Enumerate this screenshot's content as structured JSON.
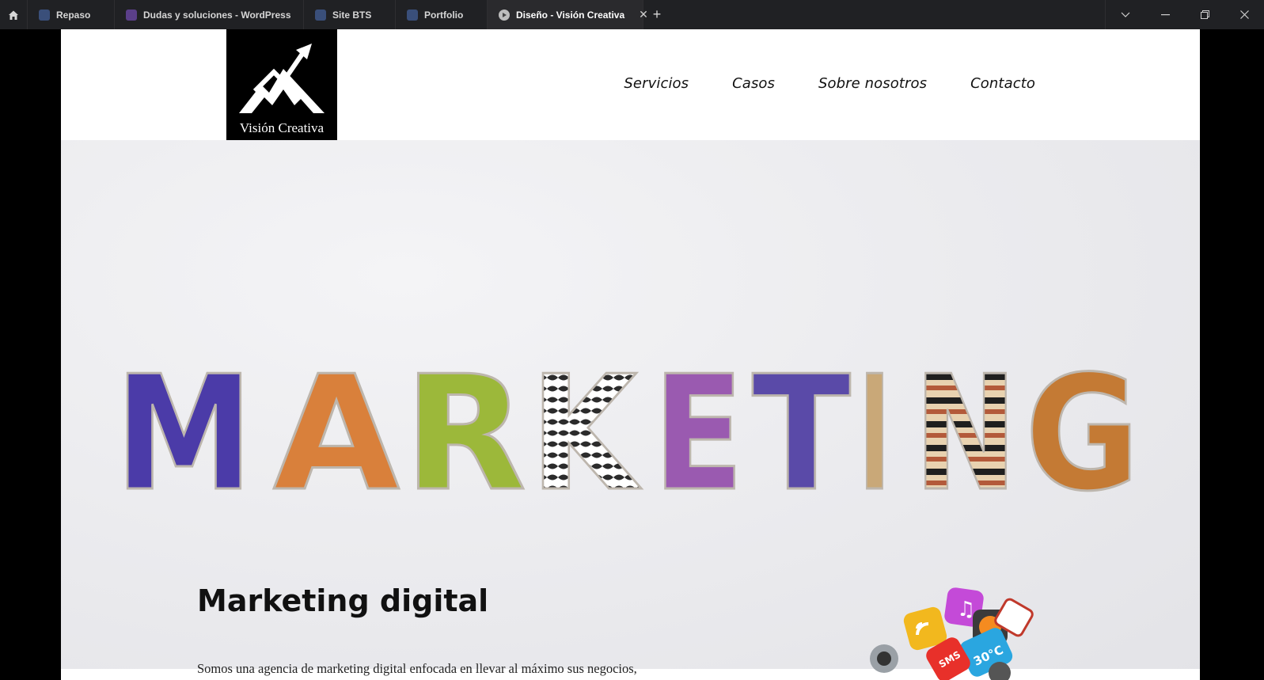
{
  "browser": {
    "tabs": [
      {
        "label": "Repaso",
        "favicon": "document-icon",
        "active": false
      },
      {
        "label": "Dudas y soluciones - WordPress",
        "favicon": "document-icon",
        "active": false
      },
      {
        "label": "Site BTS",
        "favicon": "document-icon",
        "active": false
      },
      {
        "label": "Portfolio",
        "favicon": "document-icon",
        "active": false
      },
      {
        "label": "Diseño - Visión Creativa",
        "favicon": "play-icon",
        "active": true
      }
    ],
    "close_tab_glyph": "✕",
    "new_tab_glyph": "+"
  },
  "site": {
    "logo_text": "Visión Creativa",
    "nav": [
      "Servicios",
      "Casos",
      "Sobre nosotros",
      "Contacto"
    ]
  },
  "hero": {
    "image_word": "MARKETING",
    "letter_colors": [
      "#4b3ba8",
      "#d9803b",
      "#9cb83a",
      "#2b2b2b",
      "#9a5ab0",
      "#5a4aa8",
      "#c9a878",
      "#1f1f1f",
      "#c47a34"
    ]
  },
  "section": {
    "title": "Marketing digital",
    "text": "Somos una agencia de marketing digital enfocada en llevar al máximo sus negocios,"
  }
}
